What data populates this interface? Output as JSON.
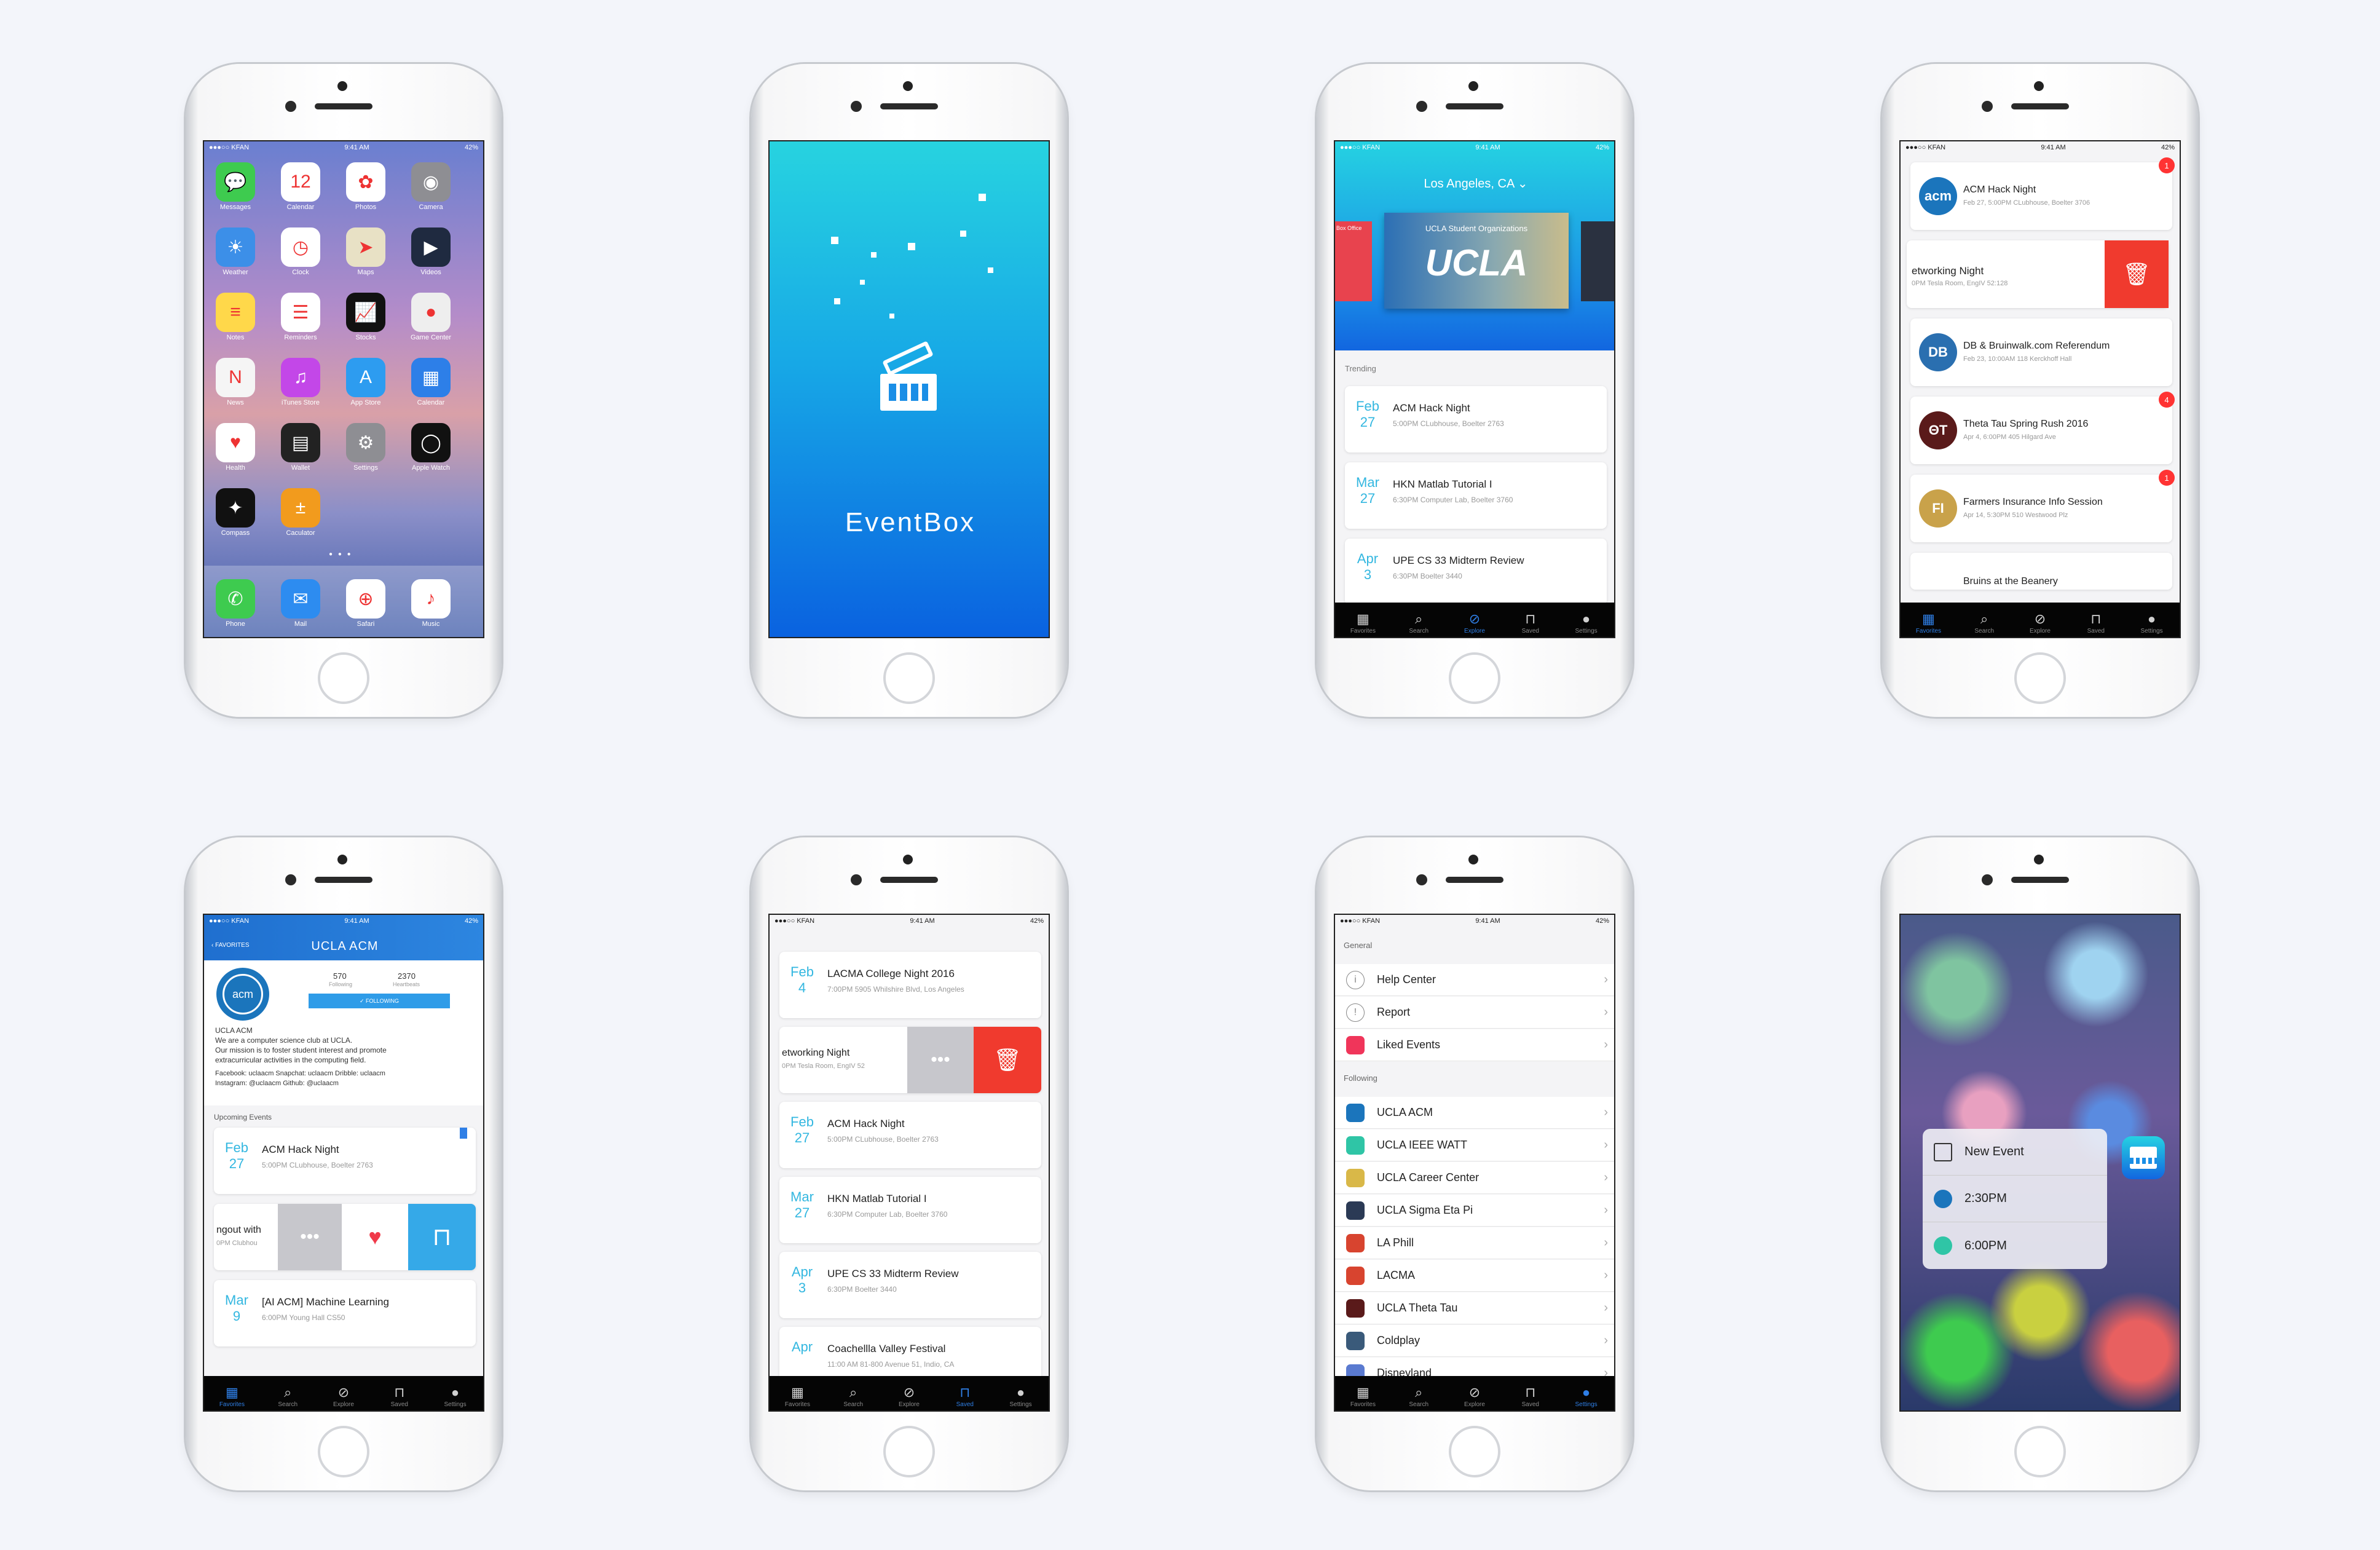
{
  "statusbar": {
    "carrier": "●●●○○ KFAN",
    "time": "9:41 AM",
    "battery": "42%"
  },
  "home": {
    "apps": [
      {
        "label": "Messages",
        "icon": "speech-bubble-icon",
        "color": "#3ecb4f",
        "glyph": "💬"
      },
      {
        "label": "Calendar",
        "icon": "calendar-icon",
        "color": "#ffffff",
        "glyph": "12"
      },
      {
        "label": "Photos",
        "icon": "photos-icon",
        "color": "#ffffff",
        "glyph": "✿"
      },
      {
        "label": "Camera",
        "icon": "camera-icon",
        "color": "#8e8e93",
        "glyph": "◉"
      },
      {
        "label": "Weather",
        "icon": "weather-icon",
        "color": "#3c8fe8",
        "glyph": "☀"
      },
      {
        "label": "Clock",
        "icon": "clock-icon",
        "color": "#ffffff",
        "glyph": "◷"
      },
      {
        "label": "Maps",
        "icon": "maps-icon",
        "color": "#e8e1c5",
        "glyph": "➤"
      },
      {
        "label": "Videos",
        "icon": "videos-icon",
        "color": "#1f2a40",
        "glyph": "▶"
      },
      {
        "label": "Notes",
        "icon": "notes-icon",
        "color": "#ffd84a",
        "glyph": "≡"
      },
      {
        "label": "Reminders",
        "icon": "reminders-icon",
        "color": "#ffffff",
        "glyph": "☰"
      },
      {
        "label": "Stocks",
        "icon": "stocks-icon",
        "color": "#111111",
        "glyph": "📈"
      },
      {
        "label": "Game Center",
        "icon": "game-center-icon",
        "color": "#eeeeee",
        "glyph": "●"
      },
      {
        "label": "News",
        "icon": "news-icon",
        "color": "#f5f5f5",
        "glyph": "N"
      },
      {
        "label": "iTunes Store",
        "icon": "itunes-icon",
        "color": "#c347e8",
        "glyph": "♫"
      },
      {
        "label": "App Store",
        "icon": "app-store-icon",
        "color": "#2d9cf0",
        "glyph": "A"
      },
      {
        "label": "Calendar",
        "icon": "calendar-blue-icon",
        "color": "#2d7fe8",
        "glyph": "▦"
      },
      {
        "label": "Health",
        "icon": "health-icon",
        "color": "#ffffff",
        "glyph": "♥"
      },
      {
        "label": "Wallet",
        "icon": "wallet-icon",
        "color": "#222222",
        "glyph": "▤"
      },
      {
        "label": "Settings",
        "icon": "settings-icon",
        "color": "#8e8e93",
        "glyph": "⚙"
      },
      {
        "label": "Apple Watch",
        "icon": "watch-icon",
        "color": "#111111",
        "glyph": "◯"
      },
      {
        "label": "Compass",
        "icon": "compass-icon",
        "color": "#111111",
        "glyph": "✦"
      },
      {
        "label": "Caculator",
        "icon": "calculator-icon",
        "color": "#f29b1d",
        "glyph": "±"
      }
    ],
    "dock": [
      {
        "label": "Phone",
        "icon": "phone-icon",
        "color": "#3ecb4f",
        "glyph": "✆"
      },
      {
        "label": "Mail",
        "icon": "mail-icon",
        "color": "#2d8cf0",
        "glyph": "✉"
      },
      {
        "label": "Safari",
        "icon": "safari-icon",
        "color": "#ffffff",
        "glyph": "⊕"
      },
      {
        "label": "Music",
        "icon": "music-icon",
        "color": "#ffffff",
        "glyph": "♪"
      }
    ]
  },
  "splash": {
    "title": "EventBox"
  },
  "explore": {
    "location": "Los Angeles, CA",
    "banner_small": "UCLA Student Organizations",
    "banner_big": "UCLA",
    "side_text": "Box Office",
    "section": "Trending",
    "events": [
      {
        "month": "Feb",
        "day": "27",
        "title": "ACM Hack Night",
        "sub": "5:00PM CLubhouse, Boelter 2763"
      },
      {
        "month": "Mar",
        "day": "27",
        "title": "HKN Matlab Tutorial I",
        "sub": "6:30PM Computer Lab, Boelter 3760"
      },
      {
        "month": "Apr",
        "day": "3",
        "title": "UPE CS 33 Midterm Review",
        "sub": "6:30PM Boelter 3440"
      }
    ]
  },
  "favorites": {
    "items": [
      {
        "title": "ACM Hack Night",
        "sub": "Feb 27, 5:00PM CLubhouse, Boelter 3706",
        "badge": "1",
        "logo": "acm",
        "color": "#1b75bc"
      },
      {
        "title": "etworking Night",
        "sub": "0PM Tesla Room, EngIV 52:128",
        "badge": "",
        "logo": "",
        "color": "#ffffff"
      },
      {
        "title": "DB & Bruinwalk.com Referendum",
        "sub": "Feb 23, 10:00AM 118 Kerckhoff Hall",
        "badge": "",
        "logo": "DB",
        "color": "#2a6fb0"
      },
      {
        "title": "Theta Tau Spring Rush 2016",
        "sub": "Apr 4, 6:00PM 405 Hilgard Ave",
        "badge": "4",
        "logo": "ΘΤ",
        "color": "#5a1a1a"
      },
      {
        "title": "Farmers Insurance Info Session",
        "sub": "Apr 14, 5:30PM 510 Westwood Plz",
        "badge": "1",
        "logo": "FI",
        "color": "#c9a24a"
      },
      {
        "title": "Bruins at the Beanery",
        "sub": "",
        "badge": "",
        "logo": "",
        "color": "#ffffff"
      }
    ]
  },
  "tabs": [
    {
      "label": "Favorites",
      "icon": "favorites-icon"
    },
    {
      "label": "Search",
      "icon": "search-icon"
    },
    {
      "label": "Explore",
      "icon": "compass-icon"
    },
    {
      "label": "Saved",
      "icon": "bookmark-icon"
    },
    {
      "label": "Settings",
      "icon": "profile-icon"
    }
  ],
  "org": {
    "back": "FAVORITES",
    "title": "UCLA ACM",
    "following": "570",
    "following_label": "Following",
    "heartbeats": "2370",
    "heartbeats_label": "Heartbeats",
    "follow_btn": "✓ FOLLOWING",
    "name": "UCLA ACM",
    "desc1": "We are a computer science club at UCLA.",
    "desc2": "Our mission is to foster student interest and promote",
    "desc3": "extracurricular activities in the computing field.",
    "social1": "Facebook: uclaacm   Snapchat: uclaacm   Dribble: uclaacm",
    "social2": "Instagram: @uclaacm   Github: @uclaacm",
    "section": "Upcoming Events",
    "events": [
      {
        "month": "Feb",
        "day": "27",
        "title": "ACM Hack Night",
        "sub": "5:00PM CLubhouse, Boelter 2763"
      },
      {
        "month": "",
        "day": "",
        "title": "ngout with",
        "sub": "0PM Clubhou"
      },
      {
        "month": "Mar",
        "day": "9",
        "title": "[AI ACM] Machine Learning",
        "sub": "6:00PM Young Hall CS50"
      }
    ]
  },
  "saved": {
    "events": [
      {
        "month": "Feb",
        "day": "4",
        "title": "LACMA College Night 2016",
        "sub": "7:00PM 5905 Whilshire Blvd, Los Angeles"
      },
      {
        "month": "",
        "day": "",
        "title": "etworking Night",
        "sub": "0PM Tesla Room, EngIV 52"
      },
      {
        "month": "Feb",
        "day": "27",
        "title": "ACM Hack Night",
        "sub": "5:00PM CLubhouse, Boelter 2763"
      },
      {
        "month": "Mar",
        "day": "27",
        "title": "HKN Matlab Tutorial I",
        "sub": "6:30PM Computer Lab, Boelter 3760"
      },
      {
        "month": "Apr",
        "day": "3",
        "title": "UPE CS 33 Midterm Review",
        "sub": "6:30PM Boelter 3440"
      },
      {
        "month": "Apr",
        "day": "",
        "title": "Coachellla Valley Festival",
        "sub": "11:00 AM 81-800 Avenue 51, Indio, CA"
      }
    ]
  },
  "settings": {
    "general_header": "General",
    "general": [
      {
        "label": "Help Center",
        "icon": "info-icon",
        "color": "#ffffff"
      },
      {
        "label": "Report",
        "icon": "report-icon",
        "color": "#ffffff"
      },
      {
        "label": "Liked Events",
        "icon": "heart-icon",
        "color": "#f0355a"
      }
    ],
    "following_header": "Following",
    "following": [
      {
        "label": "UCLA ACM",
        "icon": "acm-logo-icon",
        "color": "#1b75bc"
      },
      {
        "label": "UCLA IEEE WATT",
        "icon": "ieee-logo-icon",
        "color": "#2fc5a6"
      },
      {
        "label": "UCLA Career Center",
        "icon": "career-logo-icon",
        "color": "#d9b848"
      },
      {
        "label": "UCLA Sigma Eta Pi",
        "icon": "sigma-logo-icon",
        "color": "#2b3a55"
      },
      {
        "label": "LA Phill",
        "icon": "laphil-logo-icon",
        "color": "#d8442f"
      },
      {
        "label": "LACMA",
        "icon": "lacma-logo-icon",
        "color": "#d8442f"
      },
      {
        "label": "UCLA Theta Tau",
        "icon": "thetatau-logo-icon",
        "color": "#5a1a1a"
      },
      {
        "label": "Coldplay",
        "icon": "coldplay-logo-icon",
        "color": "#3a5a7a"
      },
      {
        "label": "Disneyland",
        "icon": "disney-logo-icon",
        "color": "#5a7ad0"
      }
    ]
  },
  "quick": {
    "items": [
      {
        "label": "New Event",
        "icon": "compose-icon"
      },
      {
        "label": "2:30PM",
        "icon": "acm-logo-icon"
      },
      {
        "label": "6:00PM",
        "icon": "ieee-logo-icon"
      }
    ]
  }
}
